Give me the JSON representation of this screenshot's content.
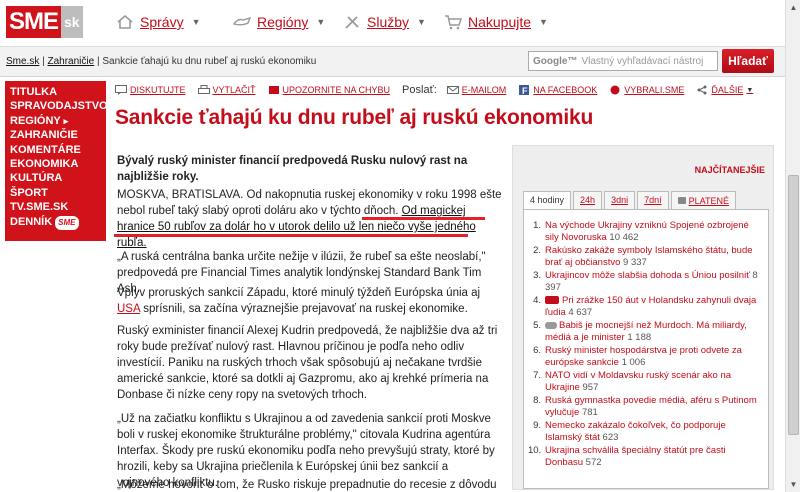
{
  "header": {
    "logo_text": "SME",
    "logo_suffix": "sk",
    "nav": [
      {
        "label": "Správy",
        "icon": "home-icon"
      },
      {
        "label": "Regióny",
        "icon": "hand-icon"
      },
      {
        "label": "Služby",
        "icon": "tools-icon"
      },
      {
        "label": "Nakupujte",
        "icon": "cart-icon"
      }
    ]
  },
  "breadcrumb": {
    "home": "Sme.sk",
    "section": "Zahraničie",
    "current": "Sankcie ťahajú ku dnu rubeľ aj ruskú ekonomiku"
  },
  "search": {
    "brand": "Google™",
    "placeholder": "Vlastný vyhľadávací nástroj",
    "button": "Hľadať"
  },
  "sidebar": {
    "items": [
      "Titulka",
      "Spravodajstvo",
      "Regióny",
      "Zahraničie",
      "Komentáre",
      "Ekonomika",
      "Kultúra",
      "Šport",
      "TV.SME.sk",
      "Denník"
    ],
    "badge": "SME",
    "regiony_arrow": "▸"
  },
  "toolbar": {
    "discuss": "Diskutujte",
    "print": "Vytlačiť",
    "report": "Upozornite na chybu",
    "post_label": "Poslať:",
    "email": "E-mailom",
    "facebook": "Na Facebook",
    "vybrali": "Vybrali.sme",
    "more": "Ďalšie"
  },
  "article": {
    "title": "Sankcie ťahajú ku dnu rubeľ aj ruskú ekonomiku",
    "lead": "Bývalý ruský minister financií predpovedá Rusku nulový rast na najbližšie roky.",
    "p1_a": "MOSKVA, BRATISLAVA. Od nakopnutia ruskej ekonomiky v roku 1998 ešte nebol rubeľ taký slabý oproti doláru ako v týchto dňoch.",
    "p1_b": "Od magickej hranice 50 rubľov za dolár ho v utorok delilo už len niečo vyše jedného rubľa.",
    "p2": "„A ruská centrálna banka určite nežije v ilúzii, že rubeľ sa ešte neoslabí,\" predpovedá pre Financial Times analytik londýnskej Standard Bank Tim Ash.",
    "p3_a": "Vplyv proruských sankcií Západu, ktoré minulý týždeň Európska únia aj",
    "p3_link": "USA",
    "p3_b": "sprísnili, sa začína výraznejšie prejavovať na ruskej ekonomike.",
    "p4": "Ruský exminister financií Alexej Kudrin predpovedá, že najbližšie dva až tri roky bude prežívať nulový rast. Hlavnou príčinou je podľa neho odliv investícií. Paniku na ruských trhoch však spôsobujú aj nečakane tvrdšie americké sankcie, ktoré sa dotkli aj Gazpromu, ako aj krehké prímeria na Donbase či nízke ceny ropy na svetových trhoch.",
    "p5": "„Už na začiatku konfliktu s Ukrajinou a od zavedenia sankcií proti Moskve boli v ruskej ekonomike štrukturálne problémy,\" citovala Kudrina agentúra Interfax. Škody pre ruskú ekonomiku podľa neho prevyšujú straty, ktoré by hrozili, keby sa Ukrajina priečlenila k Európskej únii bez sankcií a vojnového konfliktu.",
    "p6": "„Môžeme hovoriť o tom, že Rusko riskuje prepadnutie do recesie z dôvodu"
  },
  "most_read": {
    "title": "Najčítanejšie",
    "tabs": [
      "4 hodiny",
      "24h",
      "3dni",
      "7dní",
      "PLATENÉ"
    ],
    "items": [
      {
        "n": "1.",
        "t": "Na východe Ukrajiny vzniknú Spojené ozbrojené sily Novoruska",
        "c": "10 462",
        "tag": false
      },
      {
        "n": "2.",
        "t": "Rakúsko zakáže symboly Islamského štátu, bude brať aj občianstvo",
        "c": "9 337",
        "tag": false
      },
      {
        "n": "3.",
        "t": "Ukrajincov môže slabšia dohoda s Úniou posilniť",
        "c": "8 397",
        "tag": false
      },
      {
        "n": "4.",
        "t": "Pri zrážke 150 áut v Holandsku zahynuli dvaja ľudia",
        "c": "4 637",
        "tag": true
      },
      {
        "n": "5.",
        "t": "Babiš je mocnejší než Murdoch. Má miliardy, médiá a je minister",
        "c": "1 188",
        "tag": false
      },
      {
        "n": "6.",
        "t": "Ruský minister hospodárstva je proti odvete za európske sankcie",
        "c": "1 006",
        "tag": false
      },
      {
        "n": "7.",
        "t": "NATO vidí v Moldavsku ruský scenár ako na Ukrajine",
        "c": "957",
        "tag": false
      },
      {
        "n": "8.",
        "t": "Ruská gymnastka povedie médiá, aféru s Putinom vylučuje",
        "c": "781",
        "tag": false
      },
      {
        "n": "9.",
        "t": "Nemecko zakázalo čokoľvek, čo podporuje Islamský štát",
        "c": "623",
        "tag": false
      },
      {
        "n": "10.",
        "t": "Ukrajina schválila špeciálny štatút pre časti Donbasu",
        "c": "572",
        "tag": false
      }
    ]
  },
  "colors": {
    "brand": "#d0121b",
    "link": "#c40d1a"
  }
}
